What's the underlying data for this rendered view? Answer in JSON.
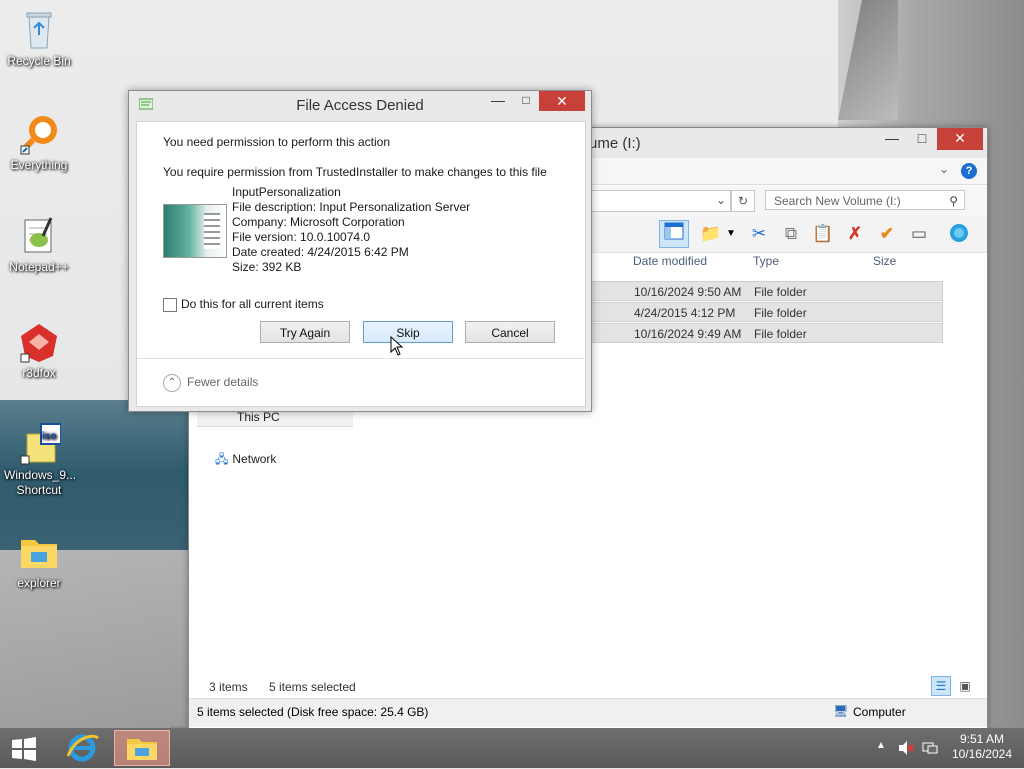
{
  "desktop": {
    "icons": [
      {
        "label": "Recycle Bin"
      },
      {
        "label": "Everything"
      },
      {
        "label": "Notepad++"
      },
      {
        "label": "r3dfox"
      },
      {
        "label": "Windows_9...",
        "label2": "Shortcut"
      },
      {
        "label": "explorer"
      }
    ]
  },
  "explorer": {
    "title": "ume (I:)",
    "search_placeholder": "Search New Volume (I:)",
    "columns": {
      "date": "Date modified",
      "type": "Type",
      "size": "Size"
    },
    "rows": [
      {
        "date": "10/16/2024 9:50 AM",
        "type": "File folder"
      },
      {
        "date": "4/24/2015 4:12 PM",
        "type": "File folder"
      },
      {
        "date": "10/16/2024 9:49 AM",
        "type": "File folder"
      }
    ],
    "nav": {
      "this_pc": "This PC",
      "network": "Network"
    },
    "status": {
      "items": "3 items",
      "selected": "5 items selected"
    },
    "statusbar": {
      "left": "5 items selected (Disk free space: 25.4 GB)",
      "right": "Computer"
    }
  },
  "dialog": {
    "title": "File Access Denied",
    "line1": "You need permission to perform this action",
    "line2": "You require permission from TrustedInstaller to make changes to this file",
    "file": {
      "name": "InputPersonalization",
      "description": "File description: Input Personalization Server",
      "company": "Company: Microsoft Corporation",
      "version": "File version: 10.0.10074.0",
      "created": "Date created: 4/24/2015 6:42 PM",
      "size": "Size: 392 KB"
    },
    "checkbox_label": "Do this for all current items",
    "buttons": {
      "try_again": "Try Again",
      "skip": "Skip",
      "cancel": "Cancel"
    },
    "fewer_details": "Fewer details"
  },
  "taskbar": {
    "time": "9:51 AM",
    "date": "10/16/2024"
  }
}
